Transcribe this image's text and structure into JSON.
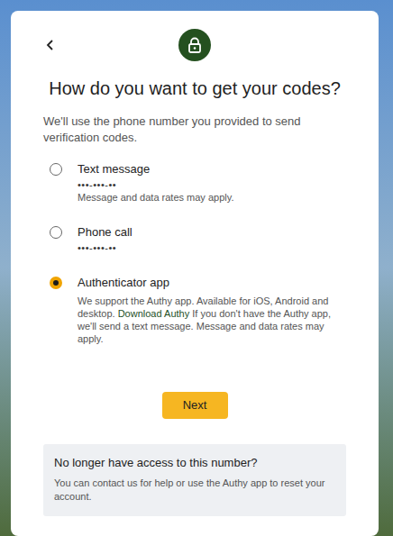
{
  "header": {
    "title": "How do you want to get your codes?",
    "subtitle": "We'll use the phone number you provided to send verification codes."
  },
  "options": [
    {
      "label": "Text message",
      "selected": false,
      "lines": [
        {
          "kind": "masked",
          "text": "•••-•••-••"
        },
        {
          "kind": "note",
          "text": "Message and data rates may apply."
        }
      ]
    },
    {
      "label": "Phone call",
      "selected": false,
      "lines": [
        {
          "kind": "masked",
          "text": "•••-•••-••"
        }
      ]
    },
    {
      "label": "Authenticator app",
      "selected": true,
      "lines": [
        {
          "kind": "rich",
          "parts": [
            {
              "kind": "text",
              "text": "We support the Authy app. Available for iOS, Android and desktop."
            },
            {
              "kind": "link",
              "text": "Download Authy"
            },
            {
              "kind": "text",
              "text": "If you don't have the Authy app, we'll send a text message. Message and data rates may apply."
            }
          ]
        }
      ]
    }
  ],
  "button": {
    "label": "Next"
  },
  "help": {
    "title": "No longer have access to this number?",
    "text": "You can contact us for help or use the Authy app to reset your account."
  }
}
